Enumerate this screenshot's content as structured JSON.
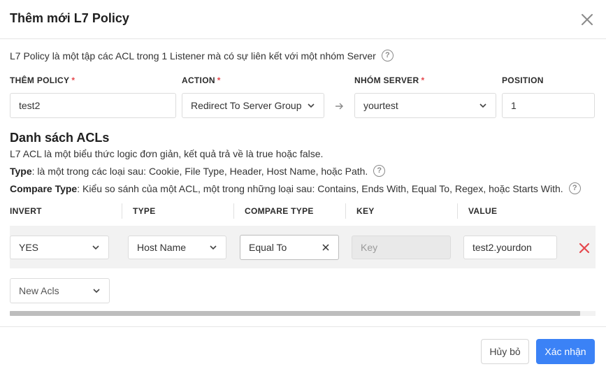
{
  "dialog": {
    "title": "Thêm mới L7 Policy",
    "description": "L7 Policy là một tập các ACL trong 1 Listener mà có sự liên kết với một nhóm Server"
  },
  "form": {
    "policy": {
      "label": "THÊM POLICY",
      "required_mark": "*",
      "value": "test2"
    },
    "action": {
      "label": "ACTION",
      "required_mark": "*",
      "value": "Redirect To Server Group"
    },
    "server_group": {
      "label": "NHÓM SERVER",
      "required_mark": "*",
      "value": "yourtest"
    },
    "position": {
      "label": "POSITION",
      "value": "1"
    }
  },
  "acl_section": {
    "title": "Danh sách ACLs",
    "line1": "L7 ACL là một biểu thức logic đơn giản, kết quả trả về là true hoặc false.",
    "type_term": "Type",
    "type_text": ": là một trong các loại sau: Cookie, File Type, Header, Host Name, hoặc Path.",
    "compare_term": "Compare Type",
    "compare_text": ": Kiểu so sánh của một ACL, một trong những loại sau: Contains, Ends With, Equal To, Regex, hoặc Starts With."
  },
  "table": {
    "headers": [
      "INVERT",
      "TYPE",
      "COMPARE TYPE",
      "KEY",
      "VALUE"
    ],
    "row": {
      "invert": "YES",
      "type": "Host Name",
      "compare_type": "Equal To",
      "key_placeholder": "Key",
      "value": "test2.yourdon"
    },
    "new_acl": "New Acls"
  },
  "footer": {
    "cancel": "Hủy bỏ",
    "confirm": "Xác nhận"
  },
  "colors": {
    "primary": "#3b82f6",
    "danger": "#e5484d"
  }
}
